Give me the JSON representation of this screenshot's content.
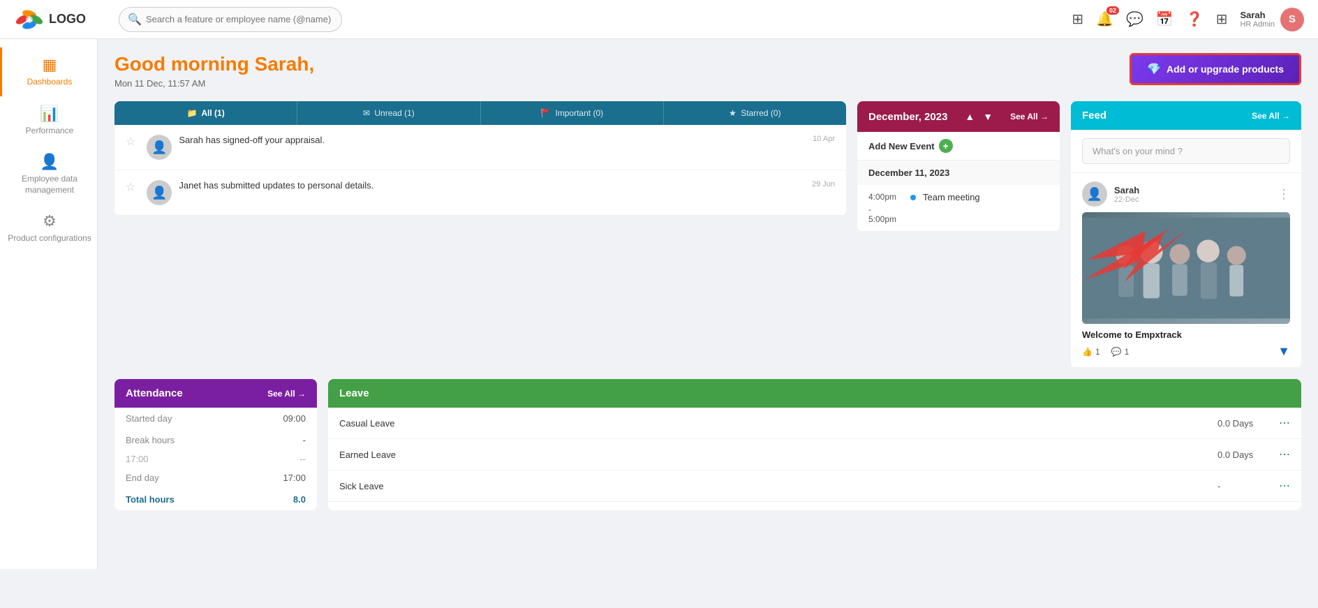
{
  "app": {
    "logo_text": "LOGO",
    "search_placeholder": "Search a feature or employee name (@name)"
  },
  "topnav": {
    "notification_count": "02",
    "user_name": "Sarah",
    "user_role": "HR Admin",
    "user_initial": "S"
  },
  "sidebar": {
    "items": [
      {
        "id": "dashboards",
        "label": "Dashboards",
        "icon": "▦",
        "active": true
      },
      {
        "id": "performance",
        "label": "Performance",
        "icon": "📊",
        "active": false
      },
      {
        "id": "employee-data",
        "label": "Employee data management",
        "icon": "👤",
        "active": false
      },
      {
        "id": "product-config",
        "label": "Product configurations",
        "icon": "⚙",
        "active": false
      }
    ]
  },
  "header": {
    "greeting_prefix": "Good morning ",
    "greeting_name": "Sarah,",
    "date": "Mon 11 Dec, 11:57 AM",
    "upgrade_btn": "Add or upgrade products"
  },
  "notifications": {
    "tabs": [
      {
        "id": "all",
        "label": "All (1)",
        "icon": "📁",
        "active": true
      },
      {
        "id": "unread",
        "label": "Unread (1)",
        "icon": "✉",
        "active": false
      },
      {
        "id": "important",
        "label": "Important (0)",
        "icon": "🚩",
        "active": false
      },
      {
        "id": "starred",
        "label": "Starred (0)",
        "icon": "★",
        "active": false
      }
    ],
    "items": [
      {
        "text": "Sarah has signed-off your appraisal.",
        "date": "10 Apr"
      },
      {
        "text": "Janet has submitted updates to personal details.",
        "date": "29 Jun"
      }
    ]
  },
  "calendar": {
    "month_year": "December, 2023",
    "see_all": "See All →",
    "add_event_label": "Add New Event",
    "event_date": "December 11, 2023",
    "events": [
      {
        "time_start": "4:00pm",
        "time_end": "5:00pm",
        "name": "Team meeting"
      }
    ]
  },
  "feed": {
    "title": "Feed",
    "see_all": "See All →",
    "input_placeholder": "What's on your mind ?",
    "post": {
      "user": "Sarah",
      "date": "22-Dec",
      "caption": "Welcome to Empxtrack",
      "likes": "1",
      "comments": "1"
    }
  },
  "attendance": {
    "title": "Attendance",
    "see_all": "See All →",
    "started_day_label": "Started day",
    "started_day_value": "09:00",
    "break_hours_label": "Break hours",
    "break_hours_value": "-",
    "time_17": "17:00",
    "dashes": "--",
    "end_day_label": "End day",
    "end_day_value": "17:00",
    "total_hours_label": "Total hours",
    "total_hours_value": "8.0"
  },
  "leave": {
    "title": "Leave",
    "items": [
      {
        "type": "Casual Leave",
        "days": "0.0 Days"
      },
      {
        "type": "Earned Leave",
        "days": "0.0 Days"
      },
      {
        "type": "Sick Leave",
        "days": "-"
      }
    ]
  }
}
